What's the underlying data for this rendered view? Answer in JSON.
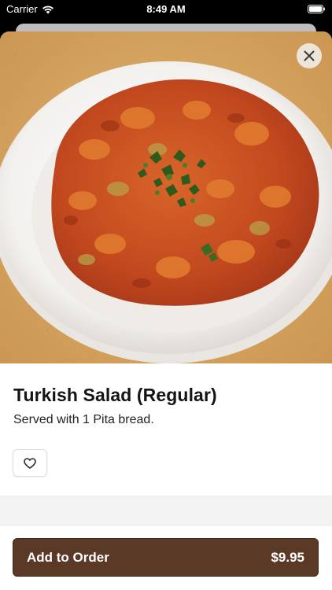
{
  "status_bar": {
    "carrier": "Carrier",
    "time": "8:49 AM",
    "wifi_icon": "wifi-icon",
    "battery_icon": "battery-icon"
  },
  "item": {
    "image_icon": "food-photo",
    "title": "Turkish Salad (Regular)",
    "description": "Served with 1 Pita bread."
  },
  "actions": {
    "close_icon": "close-icon",
    "favorite_icon": "heart-icon",
    "add_label": "Add to Order",
    "price": "$9.95"
  },
  "colors": {
    "button_brown": "#5a3a27",
    "sheet_bg": "#ffffff",
    "table_tan": "#d8a863"
  }
}
